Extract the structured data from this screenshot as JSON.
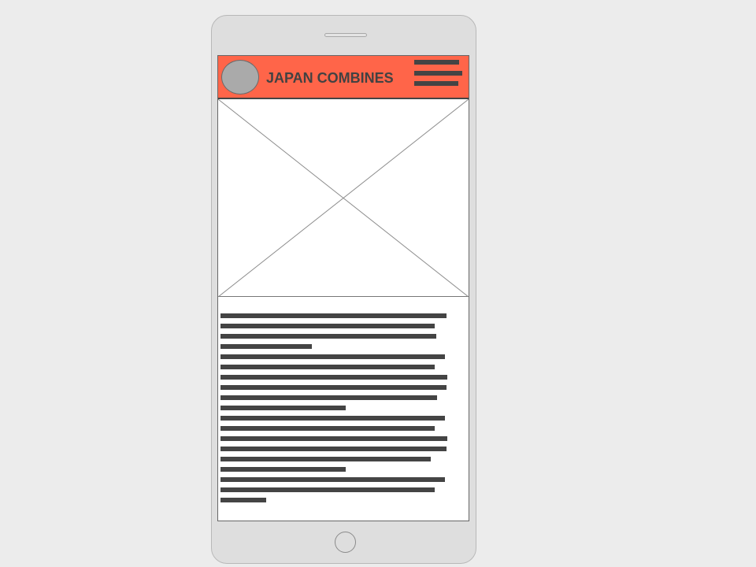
{
  "header": {
    "title": "JAPAN COMBINES",
    "logo": "logo-placeholder",
    "menu_icon": "hamburger-menu-icon",
    "background_color": "#ff6549"
  },
  "hero": {
    "type": "image-placeholder"
  },
  "content": {
    "type": "text-placeholder-lines",
    "line_fill": "#444444"
  },
  "device": {
    "type": "smartphone",
    "color": "#dedede"
  }
}
